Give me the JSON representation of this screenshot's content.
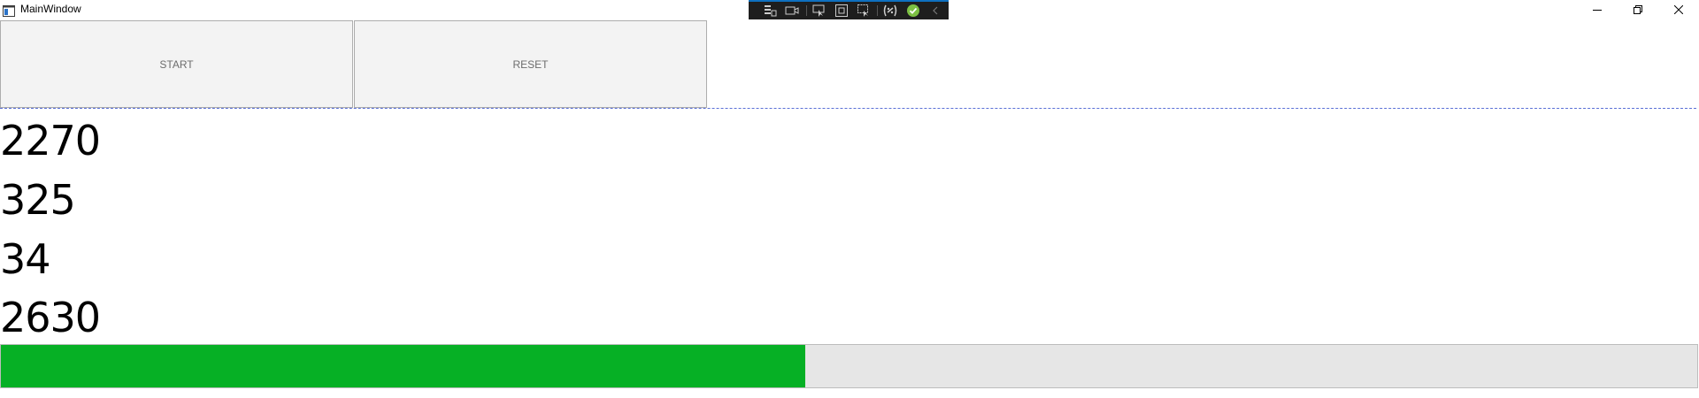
{
  "window": {
    "title": "MainWindow",
    "icon": "window-app-icon"
  },
  "caption_buttons": {
    "minimize_icon": "minimize-icon",
    "restore_icon": "restore-icon",
    "close_icon": "close-icon"
  },
  "debug_toolbar": {
    "icons": [
      "live-visual-tree-icon",
      "camera-icon",
      "select-element-icon",
      "display-layout-adorners-icon",
      "track-focus-icon",
      "binding-failures-icon",
      "hot-reload-ok-icon",
      "collapse-chevron-icon"
    ],
    "accent_color": "#0e70c0",
    "status_color": "#7cc043"
  },
  "buttons": {
    "start_label": "START",
    "reset_label": "RESET"
  },
  "counters": [
    "2270",
    "325",
    "34",
    "2630"
  ],
  "progress": {
    "value_fraction": 0.474,
    "fill_color": "#06b025"
  }
}
